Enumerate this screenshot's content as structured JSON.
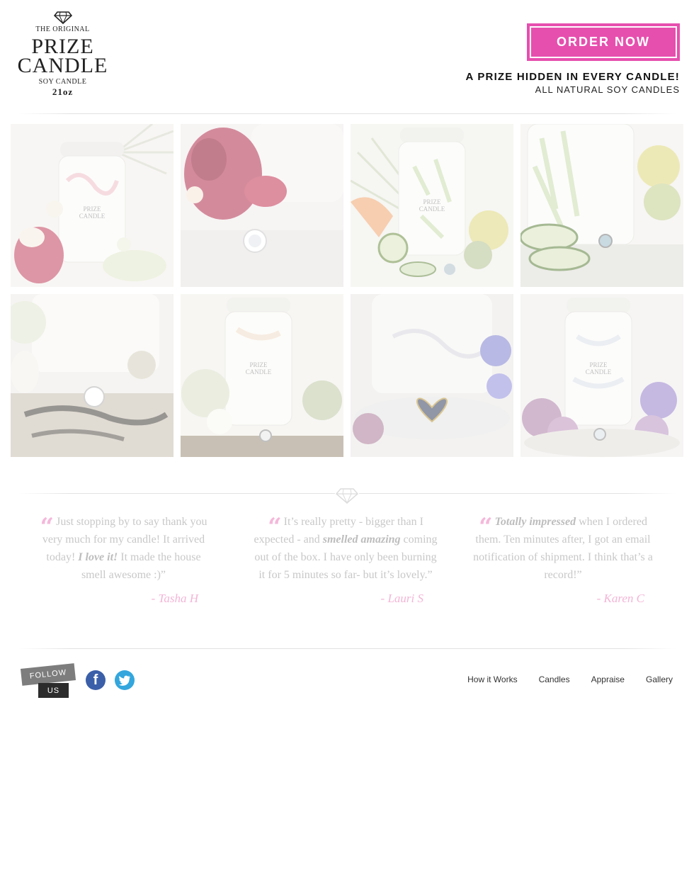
{
  "header": {
    "logo": {
      "line1": "THE ORIGINAL",
      "line2": "PRIZE",
      "line3": "CANDLE",
      "line4": "SOY CANDLE",
      "line5": "21oz"
    },
    "order_button": "ORDER NOW",
    "tagline_main": "A PRIZE HIDDEN IN EVERY CANDLE!",
    "tagline_sub": "ALL NATURAL SOY CANDLES"
  },
  "gallery": {
    "tiles": [
      {
        "icon": "candle-pink-floral-photo"
      },
      {
        "icon": "ring-red-flowers-photo"
      },
      {
        "icon": "candle-melon-cucumber-photo"
      },
      {
        "icon": "cucumber-ring-photo"
      },
      {
        "icon": "ring-tray-photo"
      },
      {
        "icon": "candle-white-flowers-photo"
      },
      {
        "icon": "heart-ring-photo"
      },
      {
        "icon": "candle-purple-roses-photo"
      }
    ]
  },
  "testimonials": [
    {
      "pre": "Just stopping by to say thank you very much for my candle! It arrived today! ",
      "emph": "I love it!",
      "post": " It made the house smell awesome :)”",
      "author": "- Tasha H"
    },
    {
      "pre": "It’s really pretty - bigger than I expected - and ",
      "emph": "smelled amazing",
      "post": " coming out of the box. I have only been burning it for 5 minutes so far- but it’s lovely.”",
      "author": "- Lauri S"
    },
    {
      "pre": "",
      "emph": "Totally impressed",
      "post": " when I ordered them. Ten minutes after, I got an email notification of shipment. I think that’s a record!”",
      "author": "- Karen C"
    }
  ],
  "footer": {
    "follow_line1": "FOLLOW",
    "follow_line2": "US",
    "facebook_glyph": "f",
    "nav": [
      "How it Works",
      "Candles",
      "Appraise",
      "Gallery"
    ]
  },
  "colors": {
    "accent": "#e64fae",
    "quote_pink": "#f4b8da",
    "facebook": "#3b5fa8",
    "twitter": "#33a6dd"
  }
}
